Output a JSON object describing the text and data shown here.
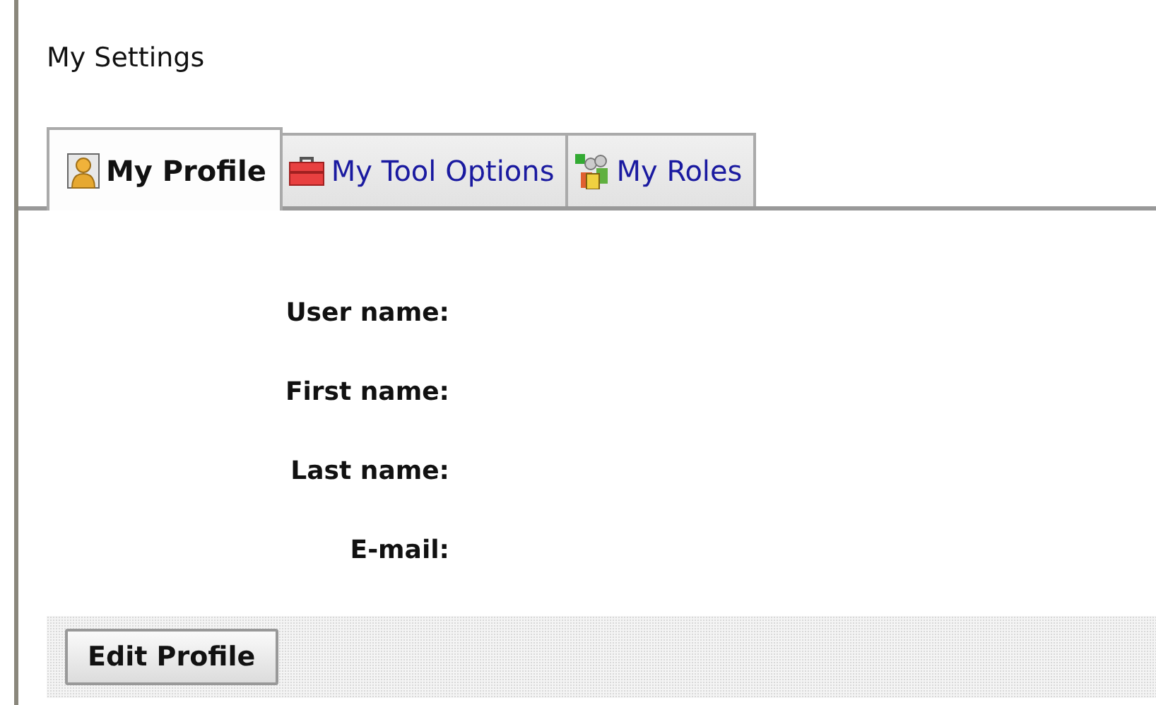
{
  "title": "My Settings",
  "tabs": [
    {
      "label": "My Profile",
      "kind": "person",
      "selected": true
    },
    {
      "label": "My Tool Options",
      "kind": "toolbox",
      "selected": false
    },
    {
      "label": "My Roles",
      "kind": "group",
      "selected": false
    }
  ],
  "fields": [
    {
      "label": "User name:"
    },
    {
      "label": "First name:"
    },
    {
      "label": "Last name:"
    },
    {
      "label": "E-mail:"
    }
  ],
  "button": "Edit Profile"
}
